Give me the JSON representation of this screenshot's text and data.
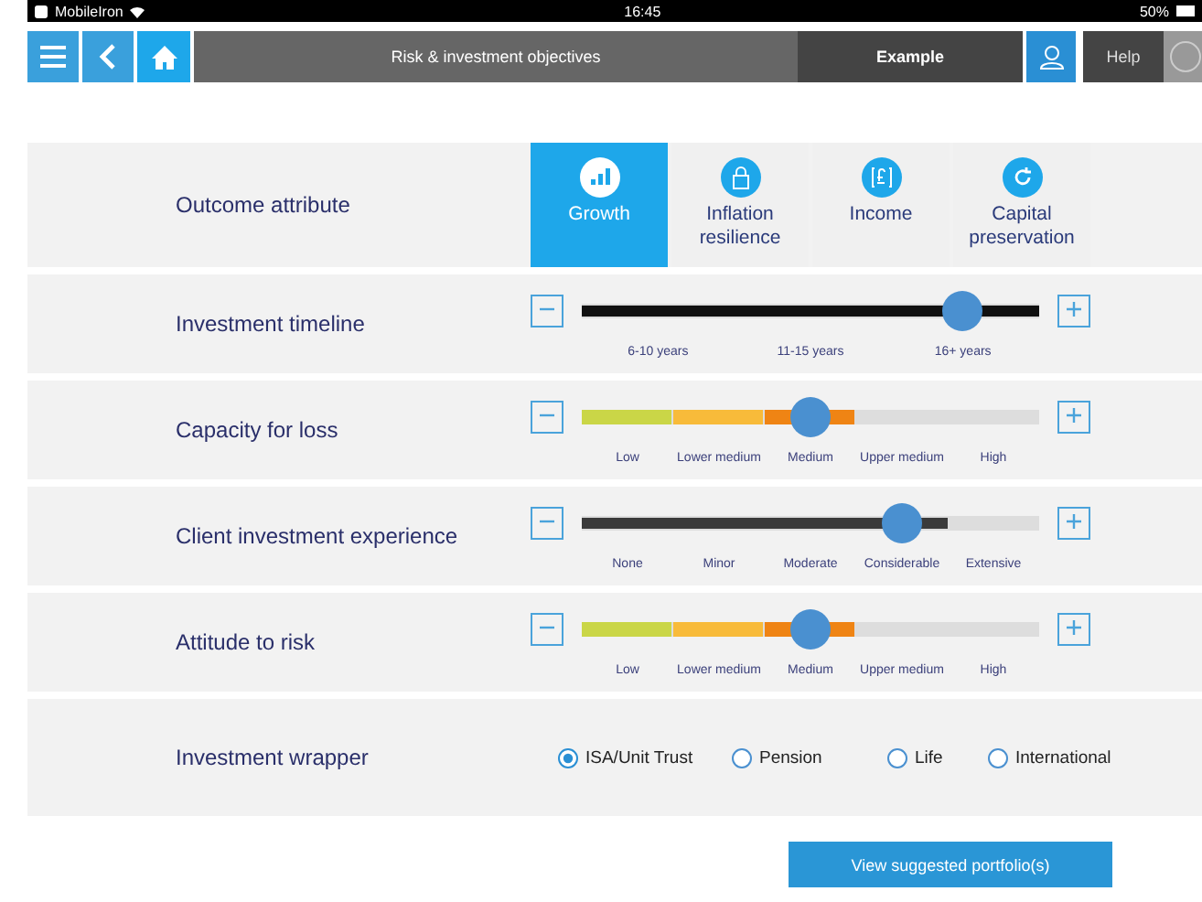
{
  "status_bar": {
    "carrier": "MobileIron",
    "time": "16:45",
    "battery": "50%"
  },
  "nav": {
    "title": "Risk & investment objectives",
    "client": "Example",
    "help": "Help"
  },
  "outcome": {
    "label": "Outcome attribute",
    "options": [
      {
        "label": "Growth",
        "selected": true
      },
      {
        "label": "Inflation resilience",
        "selected": false
      },
      {
        "label": "Income",
        "selected": false
      },
      {
        "label": "Capital preservation",
        "selected": false
      }
    ]
  },
  "sliders": [
    {
      "label": "Investment timeline",
      "kind": "timeline",
      "level": 0.83,
      "ticks": [
        "6-10 years",
        "11-15 years",
        "16+ years"
      ]
    },
    {
      "label": "Capacity for loss",
      "kind": "risk",
      "level": 0.5,
      "ticks": [
        "Low",
        "Lower medium",
        "Medium",
        "Upper medium",
        "High"
      ]
    },
    {
      "label": "Client investment experience",
      "kind": "experience",
      "level": 0.7,
      "ticks": [
        "None",
        "Minor",
        "Moderate",
        "Considerable",
        "Extensive"
      ]
    },
    {
      "label": "Attitude to risk",
      "kind": "risk",
      "level": 0.5,
      "ticks": [
        "Low",
        "Lower medium",
        "Medium",
        "Upper medium",
        "High"
      ]
    }
  ],
  "wrapper": {
    "label": "Investment wrapper",
    "options": [
      {
        "label": "ISA/Unit Trust",
        "selected": true
      },
      {
        "label": "Pension",
        "selected": false
      },
      {
        "label": "Life",
        "selected": false
      },
      {
        "label": "International",
        "selected": false
      }
    ]
  },
  "action": "View suggested portfolio(s)"
}
